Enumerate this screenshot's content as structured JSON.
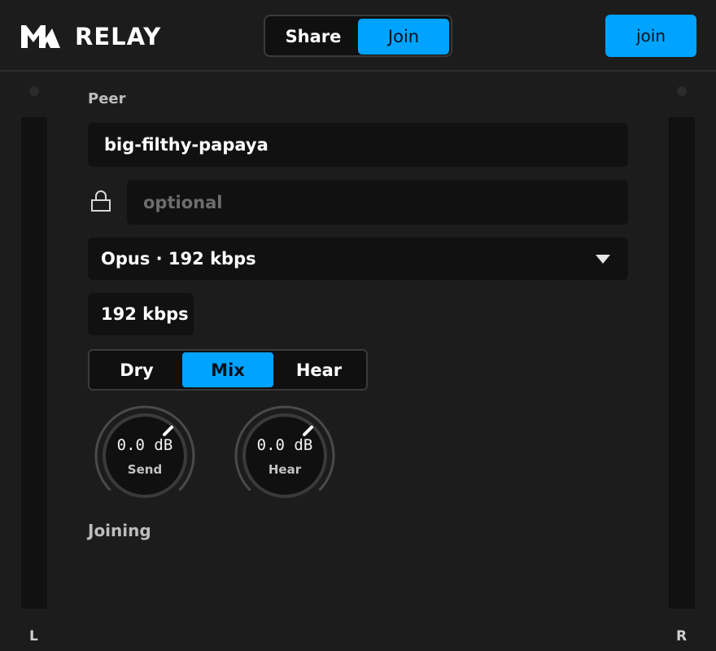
{
  "header": {
    "brand": "RELAY",
    "mode_tabs": [
      {
        "label": "Share",
        "active": false
      },
      {
        "label": "Join",
        "active": true
      }
    ],
    "action_button": "join"
  },
  "meters": {
    "left_label": "L",
    "right_label": "R"
  },
  "form": {
    "peer_label": "Peer",
    "peer_value": "big-filthy-papaya",
    "password_placeholder": "optional",
    "password_value": "",
    "codec_selected": "Opus · 192 kbps",
    "bitrate_value": "192 kbps",
    "monitor_modes": [
      {
        "label": "Dry",
        "active": false
      },
      {
        "label": "Mix",
        "active": true
      },
      {
        "label": "Hear",
        "active": false
      }
    ]
  },
  "knobs": [
    {
      "value": "0.0 dB",
      "label": "Send"
    },
    {
      "value": "0.0 dB",
      "label": "Hear"
    }
  ],
  "status": "Joining",
  "colors": {
    "accent": "#00a3ff",
    "background": "#1c1c1c",
    "field": "#111111"
  },
  "icons": {
    "logo": "relay-logo-icon",
    "lock": "lock-icon",
    "dropdown": "caret-down-icon"
  }
}
